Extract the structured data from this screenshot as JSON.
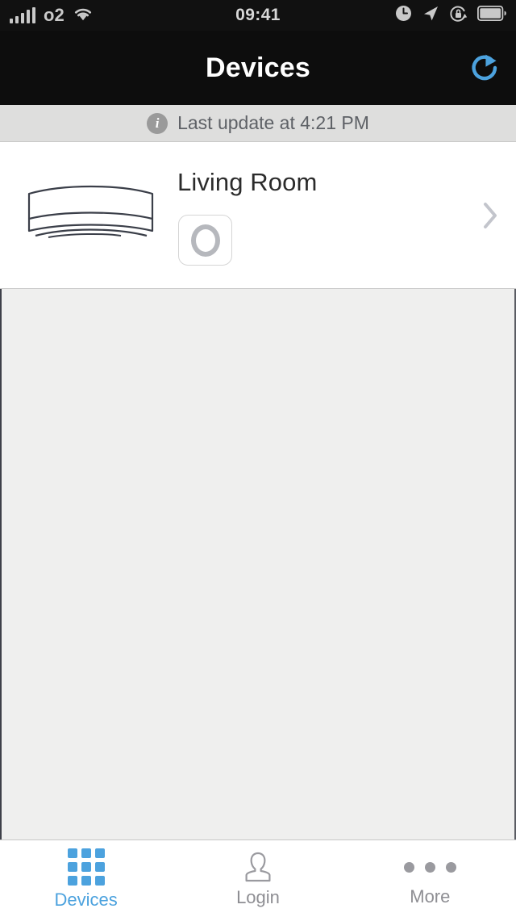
{
  "status_bar": {
    "carrier": "o2",
    "time": "09:41",
    "icons": {
      "signal": "signal-bars-icon",
      "wifi": "wifi-icon",
      "alarm": "alarm-clock-icon",
      "location": "location-arrow-icon",
      "rotation_lock": "rotation-lock-icon",
      "battery": "battery-icon"
    }
  },
  "navbar": {
    "title": "Devices",
    "refresh_icon": "refresh-icon",
    "background": "#0d0d0d",
    "title_color": "#ffffff",
    "refresh_color": "#4ca2de"
  },
  "banner": {
    "info_icon": "info-icon",
    "info_glyph": "i",
    "text": "Last update at 4:21 PM",
    "background": "#dededd",
    "text_color": "#5e6166"
  },
  "devices": [
    {
      "name": "Living Room",
      "thumbnail_icon": "air-conditioner-icon",
      "power_state": "off",
      "power_icon": "power-ring-icon",
      "disclosure_icon": "chevron-right-icon"
    }
  ],
  "tabbar": {
    "active_index": 0,
    "active_color": "#4ca2de",
    "inactive_color": "#8e8e93",
    "items": [
      {
        "label": "Devices",
        "icon": "grid-icon"
      },
      {
        "label": "Login",
        "icon": "person-icon"
      },
      {
        "label": "More",
        "icon": "ellipsis-icon"
      }
    ]
  }
}
